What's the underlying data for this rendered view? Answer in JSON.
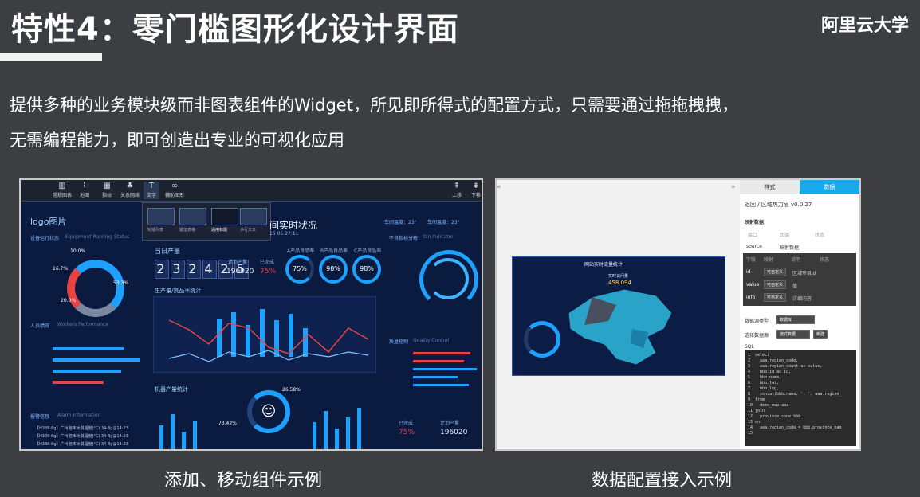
{
  "slide": {
    "title": "特性4：零门槛图形化设计界面",
    "brand": "阿里云大学",
    "desc_line1": "提供多种的业务模块级而非图表组件的Widget，所见即所得式的配置方式，只需要通过拖拖拽拽，",
    "desc_line2": "无需编程能力，即可创造出专业的可视化应用",
    "caption_left": "添加、移动组件示例",
    "caption_right": "数据配置接入示例"
  },
  "left_shot": {
    "toolbar": [
      {
        "icon": "chart-icon",
        "label": "常规图表"
      },
      {
        "icon": "map-icon",
        "label": "地图"
      },
      {
        "icon": "indicator-icon",
        "label": "指标"
      },
      {
        "icon": "network-icon",
        "label": "关系网络"
      },
      {
        "icon": "text-icon",
        "label": "文字"
      },
      {
        "icon": "decoration-icon",
        "label": "辅助图形"
      }
    ],
    "toolbar_right": [
      {
        "label": "上移"
      },
      {
        "label": "下移"
      }
    ],
    "popup_items": [
      "轮播列表",
      "键值表格",
      "通用标题",
      "多行文本"
    ],
    "logo": "logo图片",
    "header": "间实时状况",
    "header_time": "15 05:27:11",
    "weather_left": "车间温度：23°",
    "weather_right": "车间温度：23°",
    "panel_titles": {
      "equipment": "设备运行状态",
      "equipment_en": "Equipment Running Status",
      "today": "当日产量",
      "workers": "人员绩效",
      "workers_en": "Workers Performance",
      "distribution": "不良指标分布",
      "distribution_en": "Yan Indicator",
      "yield": "生产量/良品率统计",
      "machine": "机器产量统计",
      "quality": "质量控制",
      "quality_en": "Quality Control",
      "alarm": "报警信息",
      "alarm_en": "Alarm Information"
    },
    "big_number": [
      "2",
      "3",
      "2",
      "4",
      "2",
      "5"
    ],
    "planned_label": "计划产量",
    "planned_value": "196020",
    "completed_label": "已完成",
    "completed_value": "75%",
    "rate_labels": [
      "A产品良品率",
      "B产品良品率",
      "C产品良品率"
    ],
    "rates": [
      "75%",
      "98%",
      "98%"
    ],
    "donut_labels": [
      "10.0%",
      "16.7%",
      "53.3%",
      "20.0%"
    ],
    "pie_values": [
      "26.58%",
      "73.42%"
    ],
    "bottom_completed": "75%",
    "bottom_planned": "196020",
    "alarm_rows": [
      "【H338-8g】广州泡味冰淇温度(°C)  34-8g@14:23",
      "【H338-8g】广州泡味冰淇温度(°C)  34-8g@14:23",
      "【H338-8g】广州泡味冰淇温度(°C)  34-8g@14:23"
    ]
  },
  "right_shot": {
    "map_title": "网站实时流量统计",
    "map_sub": "实时访问量",
    "map_value": "458.094",
    "cfg_tabs": [
      "样式",
      "数据"
    ],
    "breadcrumb": "返回 / 区域热力层 v0.0.27",
    "mapping_title": "映射数据",
    "mapping_cols": [
      "接口",
      "回调",
      "状态"
    ],
    "source_label": "source",
    "source_value": "映射数据",
    "field_cols": [
      "字段",
      "映射",
      "说明",
      "状态"
    ],
    "fields": [
      {
        "name": "id",
        "map": "可自定义",
        "desc": "区域市县id"
      },
      {
        "name": "value",
        "map": "可自定义",
        "desc": "值"
      },
      {
        "name": "info",
        "map": "可自定义",
        "desc": "详细内容"
      }
    ],
    "ds_type_label": "数据源类型",
    "ds_type_value": "数据库",
    "ds_select_label": "选择数据源",
    "ds_select_value": "流式数据",
    "ds_new": "新建",
    "sql_label": "SQL",
    "sql_lines": [
      "1  select",
      "2    aaa.region_code,",
      "3    aaa.region_count as value,",
      "4    bbb.id as id,",
      "5    bbb.name,",
      "6    bbb.lat,",
      "7    bbb.lng,",
      "8    concat(bbb.name, ': ', aaa.region_",
      "9  from",
      "10   demo_map aaa",
      "11 join",
      "12   province_code bbb",
      "13 on",
      "14   aaa.region_code = bbb.province_nam",
      "15"
    ]
  },
  "colors": {
    "background": "#3c3e42",
    "dash_bg": "#0b1a3f",
    "accent_blue": "#1ea0ff",
    "accent_red": "#e84242",
    "tab_active": "#19a8e8"
  }
}
